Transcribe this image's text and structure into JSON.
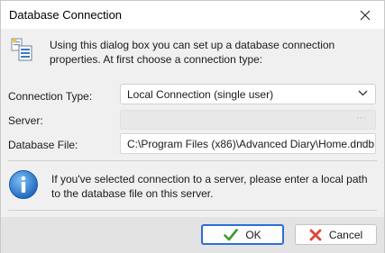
{
  "window": {
    "title": "Database Connection"
  },
  "intro": {
    "text": "Using this dialog box you can set up a database connection properties. At first choose a connection type:"
  },
  "form": {
    "connection_type_label": "Connection Type:",
    "connection_type_value": "Local Connection (single user)",
    "server_label": "Server:",
    "server_value": "",
    "database_file_label": "Database File:",
    "database_file_value": "C:\\Program Files (x86)\\Advanced Diary\\Home.dndb",
    "browse_label": "···"
  },
  "info": {
    "text": "If you've selected connection to a server, please enter a local path to the database file on this server."
  },
  "buttons": {
    "ok_label": "OK",
    "cancel_label": "Cancel"
  },
  "icons": {
    "close": "close-icon",
    "intro": "database-connection-icon",
    "info": "info-icon",
    "ok": "checkmark-icon",
    "cancel": "cross-icon",
    "combo": "chevron-down-icon"
  },
  "colors": {
    "ok_border": "#2a6fd6",
    "check_green": "#3a9b2e",
    "cancel_red": "#e0443a",
    "info_blue": "#2f7fd0"
  }
}
